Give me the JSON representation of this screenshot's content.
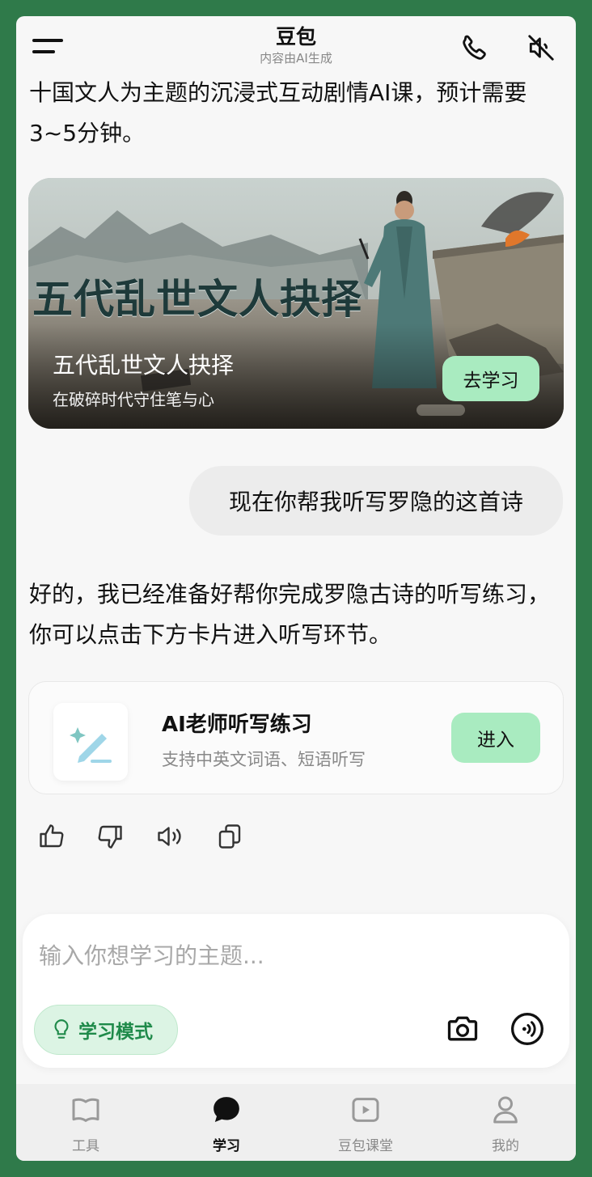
{
  "header": {
    "title": "豆包",
    "subtitle": "内容由AI生成"
  },
  "messages": {
    "ai_intro": "十国文人为主题的沉浸式互动剧情AI课，预计需要3~5分钟。",
    "user": "现在你帮我听写罗隐的这首诗",
    "ai_reply": "好的，我已经准备好帮你完成罗隐古诗的听写练习，你可以点击下方卡片进入听写环节。"
  },
  "course_card": {
    "image_title": "五代乱世文人抉择",
    "title": "五代乱世文人抉择",
    "subtitle": "在破碎时代守住笔与心",
    "button": "去学习"
  },
  "dictation_card": {
    "title": "AI老师听写练习",
    "subtitle": "支持中英文词语、短语听写",
    "button": "进入",
    "icon": "magic-pen-icon"
  },
  "actions": [
    "thumbs-up-icon",
    "thumbs-down-icon",
    "speaker-icon",
    "copy-icon"
  ],
  "input": {
    "placeholder": "输入你想学习的主题...",
    "mode_label": "学习模式"
  },
  "tabs": [
    {
      "label": "工具",
      "icon": "book-icon",
      "active": false
    },
    {
      "label": "学习",
      "icon": "chat-bubble-icon",
      "active": true
    },
    {
      "label": "豆包课堂",
      "icon": "play-video-icon",
      "active": false
    },
    {
      "label": "我的",
      "icon": "person-icon",
      "active": false
    }
  ],
  "colors": {
    "accent_button": "#a9ebc0",
    "study_mode_text": "#1f8a4a",
    "frame": "#2f7a4a"
  }
}
